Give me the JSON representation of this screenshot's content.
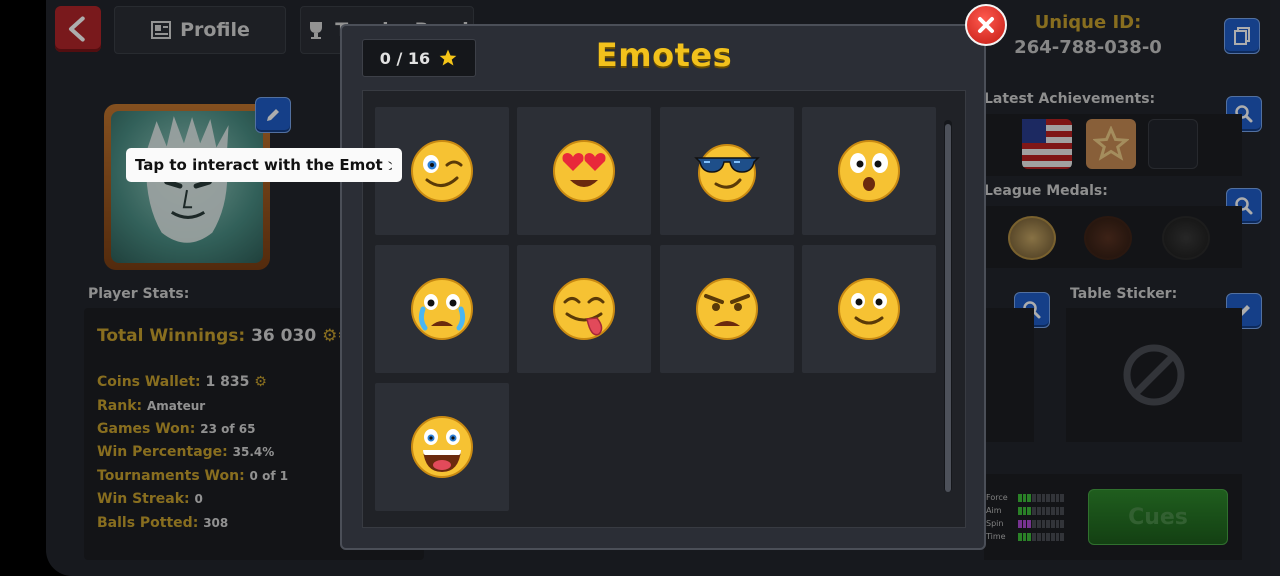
{
  "header": {
    "profile_tab": "Profile",
    "trophy_tab": "Trophy Road",
    "unique_id_label": "Unique ID:",
    "unique_id_value": "264-788-038-0"
  },
  "stats": {
    "section_label": "Player Stats:",
    "total_winnings_label": "Total Winnings:",
    "total_winnings_value": "36 030",
    "items": [
      {
        "label": "Coins Wallet:",
        "value": "1 835"
      },
      {
        "label": "Rank:",
        "value": "Amateur"
      },
      {
        "label": "Games Won:",
        "value": "23 of 65"
      },
      {
        "label": "Win Percentage:",
        "value": "35.4%"
      },
      {
        "label": "Tournaments Won:",
        "value": "0 of 1"
      },
      {
        "label": "Win Streak:",
        "value": "0"
      },
      {
        "label": "Balls Potted:",
        "value": "308"
      }
    ]
  },
  "right": {
    "achievements_label": "Latest Achievements:",
    "league_label": "League Medals:",
    "sticker_label": "Table Sticker:",
    "bars": [
      "Force",
      "Aim",
      "Spin",
      "Time"
    ],
    "bar_levels": [
      3,
      3,
      3,
      3
    ],
    "bar_colors": [
      "#3fbf3a",
      "#3fbf3a",
      "#b04cd6",
      "#3fbf3a"
    ],
    "cues_button": "Cues"
  },
  "modal": {
    "title": "Emotes",
    "counter": "0 / 16",
    "tooltip": "Tap to interact with the Emote",
    "emotes": [
      "wink-emote",
      "heart-eyes-emote",
      "sunglasses-emote",
      "surprised-emote",
      "crying-emote",
      "tongue-out-emote",
      "angry-emote",
      "smiling-emote",
      "laughing-emote"
    ]
  },
  "colors": {
    "accent_gold": "#c9a22f",
    "title_yellow": "#f2c11c",
    "button_blue": "#1f5ec9",
    "close_red": "#d3231a"
  }
}
